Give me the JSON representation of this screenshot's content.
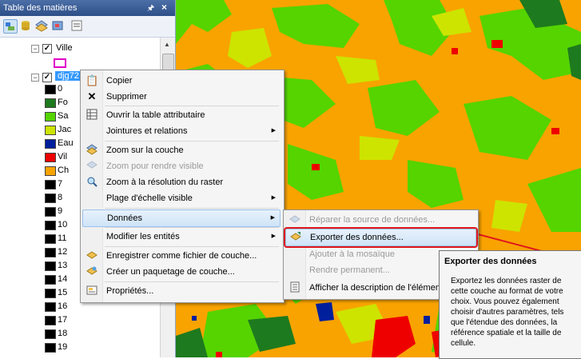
{
  "toc": {
    "title": "Table des matières",
    "pin": "p",
    "close": "×",
    "layers": [
      {
        "name": "Ville"
      },
      {
        "name": "djg72"
      }
    ],
    "legend": [
      {
        "label": "0",
        "color": "#000000"
      },
      {
        "label": "Fo",
        "color": "#1e7a1e"
      },
      {
        "label": "Sa",
        "color": "#55d400"
      },
      {
        "label": "Jac",
        "color": "#cde400"
      },
      {
        "label": "Eau",
        "color": "#001f9c"
      },
      {
        "label": "Vil",
        "color": "#ee0000"
      },
      {
        "label": "Ch",
        "color": "#f8a300"
      },
      {
        "label": "7",
        "color": "#000000"
      },
      {
        "label": "8",
        "color": "#000000"
      },
      {
        "label": "9",
        "color": "#000000"
      },
      {
        "label": "10",
        "color": "#000000"
      },
      {
        "label": "11",
        "color": "#000000"
      },
      {
        "label": "12",
        "color": "#000000"
      },
      {
        "label": "13",
        "color": "#000000"
      },
      {
        "label": "14",
        "color": "#000000"
      },
      {
        "label": "15",
        "color": "#000000"
      },
      {
        "label": "16",
        "color": "#000000"
      },
      {
        "label": "17",
        "color": "#000000"
      },
      {
        "label": "18",
        "color": "#000000"
      },
      {
        "label": "19",
        "color": "#000000"
      }
    ]
  },
  "context_menu": {
    "items": [
      {
        "label": "Copier",
        "icon": "copy-icon"
      },
      {
        "label": "Supprimer",
        "icon": "delete-icon"
      },
      {
        "label": "Ouvrir la table attributaire",
        "icon": "table-icon"
      },
      {
        "label": "Jointures et relations"
      },
      {
        "label": "Zoom sur la couche",
        "icon": "zoom-layer-icon"
      },
      {
        "label": "Zoom pour rendre visible",
        "icon": "zoom-visible-icon"
      },
      {
        "label": "Zoom à la résolution du raster",
        "icon": "zoom-raster-icon"
      },
      {
        "label": "Plage d'échelle visible"
      },
      {
        "label": "Données"
      },
      {
        "label": "Modifier les entités"
      },
      {
        "label": "Enregistrer comme fichier de couche...",
        "icon": "layer-file-icon"
      },
      {
        "label": "Créer un paquetage de couche...",
        "icon": "layer-package-icon"
      },
      {
        "label": "Propriétés...",
        "icon": "properties-icon"
      }
    ]
  },
  "submenu": {
    "items": [
      {
        "label": "Réparer la source de données..."
      },
      {
        "label": "Exporter des données..."
      },
      {
        "label": "Ajouter à la mosaïque"
      },
      {
        "label": "Rendre permanent..."
      },
      {
        "label": "Afficher la description de l'élémen"
      }
    ]
  },
  "tooltip": {
    "title": "Exporter des données",
    "body": "Exportez les données raster de cette couche au format de votre choix. Vous pouvez également choisir d'autres paramètres, tels que l'étendue des données, la référence spatiale et la taille de cellule."
  },
  "colors": {
    "map_orange": "#f8a300",
    "map_green": "#55d400",
    "map_yellow": "#cde400",
    "map_dark_green": "#1e7a1e",
    "map_red": "#ee0000",
    "map_blue": "#001f9c",
    "highlight_red": "#e0161c"
  }
}
